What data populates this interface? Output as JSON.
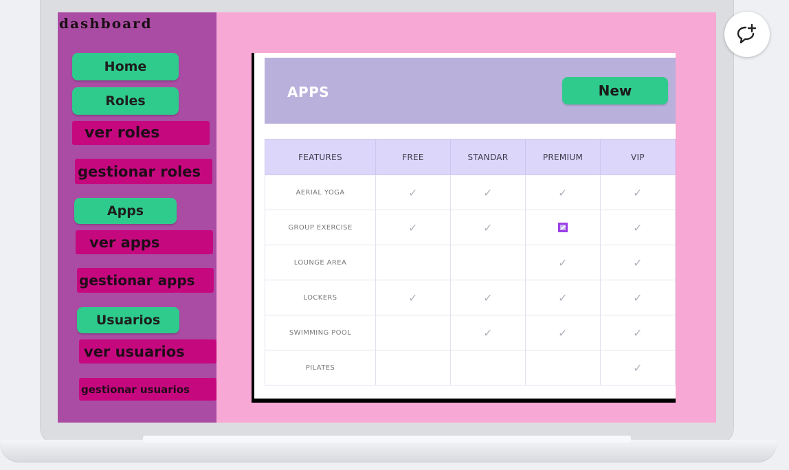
{
  "sidebar": {
    "brand": "dashboard",
    "sections": [
      {
        "label": "Home"
      },
      {
        "label": "Roles",
        "links": [
          "ver roles",
          "gestionar roles"
        ]
      },
      {
        "label": "Apps",
        "links": [
          "ver apps",
          "gestionar apps"
        ]
      },
      {
        "label": "Usuarios",
        "links": [
          "ver usuarios",
          "gestionar usuarios"
        ]
      }
    ]
  },
  "main": {
    "title": "APPS",
    "new_button_label": "New",
    "table": {
      "headers": [
        "FEATURES",
        "FREE",
        "STANDAR",
        "PREMIUM",
        "VIP"
      ],
      "rows": [
        {
          "feature": "AERIAL YOGA",
          "cells": [
            "check",
            "check",
            "check",
            "check"
          ]
        },
        {
          "feature": "GROUP EXERCISE",
          "cells": [
            "check",
            "check",
            "checkbox",
            "check"
          ]
        },
        {
          "feature": "LOUNGE AREA",
          "cells": [
            "",
            "",
            "check",
            "check"
          ]
        },
        {
          "feature": "LOCKERS",
          "cells": [
            "check",
            "check",
            "check",
            "check"
          ]
        },
        {
          "feature": "SWIMMING POOL",
          "cells": [
            "",
            "check",
            "check",
            "check"
          ]
        },
        {
          "feature": "PILATES",
          "cells": [
            "",
            "",
            "",
            "check"
          ]
        }
      ]
    }
  },
  "icons": {
    "check": "checkmark-icon",
    "checkbox": "checked-box-icon",
    "comment": "add-comment-icon"
  },
  "colors": {
    "screen_bg": "#f8a8d4",
    "sidebar_bg": "#ab4ca4",
    "nav_button": "#2fcb8d",
    "sub_link": "#c6087f",
    "header_bg": "#bab0dc",
    "table_header_bg": "#ddd6fb"
  }
}
